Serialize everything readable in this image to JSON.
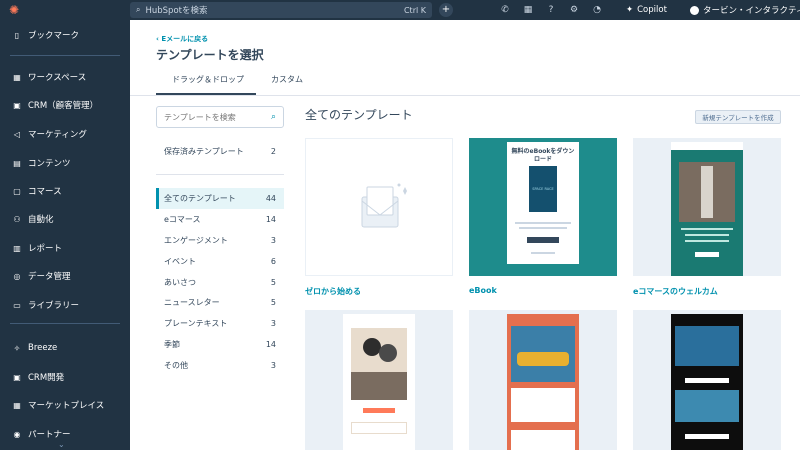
{
  "topbar": {
    "search_placeholder": "HubSpotを検索",
    "search_shortcut": "Ctrl K",
    "copilot": "Copilot",
    "account": "タービン・インタラクティブ"
  },
  "sidebar": {
    "items": [
      {
        "label": "ブックマーク",
        "icon": "bookmark-icon"
      },
      {
        "label": "ワークスペース",
        "icon": "grid-icon"
      },
      {
        "label": "CRM（顧客管理）",
        "icon": "crm-icon"
      },
      {
        "label": "マーケティング",
        "icon": "megaphone-icon"
      },
      {
        "label": "コンテンツ",
        "icon": "content-icon"
      },
      {
        "label": "コマース",
        "icon": "commerce-icon"
      },
      {
        "label": "自動化",
        "icon": "automation-icon"
      },
      {
        "label": "レポート",
        "icon": "report-icon"
      },
      {
        "label": "データ管理",
        "icon": "database-icon"
      },
      {
        "label": "ライブラリー",
        "icon": "folder-icon"
      },
      {
        "label": "Breeze",
        "icon": "breeze-icon"
      },
      {
        "label": "CRM開発",
        "icon": "dev-icon"
      },
      {
        "label": "マーケットプレイス",
        "icon": "marketplace-icon"
      },
      {
        "label": "パートナー",
        "icon": "partner-icon"
      }
    ]
  },
  "main": {
    "back_link": "Eメールに戻る",
    "title": "テンプレートを選択",
    "tabs": [
      {
        "label": "ドラッグ＆ドロップ"
      },
      {
        "label": "カスタム"
      }
    ],
    "search_placeholder": "テンプレートを検索",
    "saved": {
      "label": "保存済みテンプレート",
      "count": "2"
    },
    "categories": [
      {
        "label": "全てのテンプレート",
        "count": "44"
      },
      {
        "label": "eコマース",
        "count": "14"
      },
      {
        "label": "エンゲージメント",
        "count": "3"
      },
      {
        "label": "イベント",
        "count": "6"
      },
      {
        "label": "あいさつ",
        "count": "5"
      },
      {
        "label": "ニュースレター",
        "count": "5"
      },
      {
        "label": "プレーンテキスト",
        "count": "3"
      },
      {
        "label": "季節",
        "count": "14"
      },
      {
        "label": "その他",
        "count": "3"
      }
    ],
    "heading": "全てのテンプレート",
    "new_button": "新規テンプレートを作成",
    "cards": [
      {
        "label": "ゼロから始める"
      },
      {
        "label": "eBook",
        "preview_title": "無料のeBookをダウンロード",
        "cover": "SPACE RACE"
      },
      {
        "label": "eコマースのウェルカム"
      }
    ]
  }
}
